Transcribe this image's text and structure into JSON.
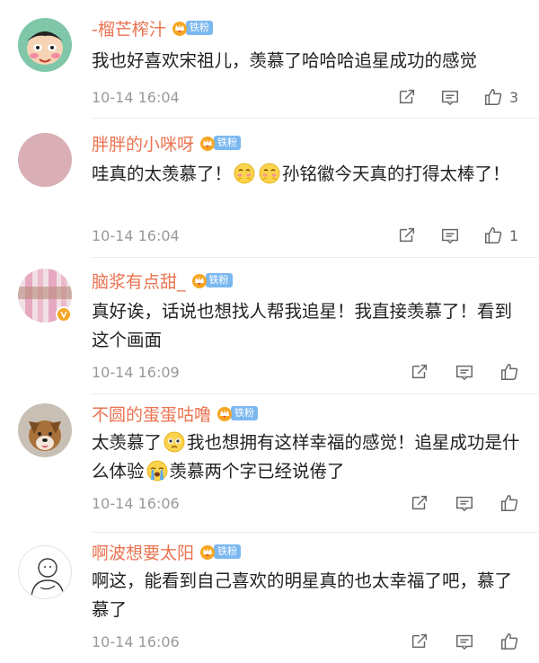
{
  "colors": {
    "username": "#eb7350",
    "timestamp": "#999999",
    "fan_badge_bg": "#7bb8f0",
    "verified": "#f6a623"
  },
  "fan_badge_label": "铁粉",
  "comments": [
    {
      "username": "-榴芒榨汁",
      "avatar_icon": "cartoon-boy-avatar-icon",
      "text": "我也好喜欢宋祖儿，羡慕了哈哈哈追星成功的感觉",
      "time": "10-14 16:04",
      "likes": "3"
    },
    {
      "username": "胖胖的小咪呀",
      "avatar_icon": "pink-circle-avatar-icon",
      "text_before": "哇真的太羡慕了！",
      "emojis": [
        "blush-emoji-icon",
        "blush-emoji-icon"
      ],
      "text_after": "孙铭徽今天真的打得太棒了！",
      "time": "10-14 16:04",
      "likes": "1"
    },
    {
      "username": "脑浆有点甜_",
      "avatar_icon": "pink-curtain-avatar-icon",
      "verified": true,
      "text": "真好诶，话说也想找人帮我追星！我直接羡慕了！看到这个画面",
      "time": "10-14 16:09",
      "likes": ""
    },
    {
      "username": "不圆的蛋蛋咕噜",
      "avatar_icon": "dog-photo-avatar-icon",
      "text_a": "太羡慕了",
      "emoji_1": "pitiful-emoji-icon",
      "text_b": "我也想拥有这样幸福的感觉！追星成功是什么体验",
      "emoji_2": "crying-emoji-icon",
      "text_c": "羡慕两个字已经说倦了",
      "time": "10-14 16:06",
      "likes": ""
    },
    {
      "username": "啊波想要太阳",
      "avatar_icon": "line-drawing-avatar-icon",
      "text": "啊这，能看到自己喜欢的明星真的也太幸福了吧，慕了慕了",
      "time": "10-14 16:06",
      "likes": ""
    }
  ]
}
